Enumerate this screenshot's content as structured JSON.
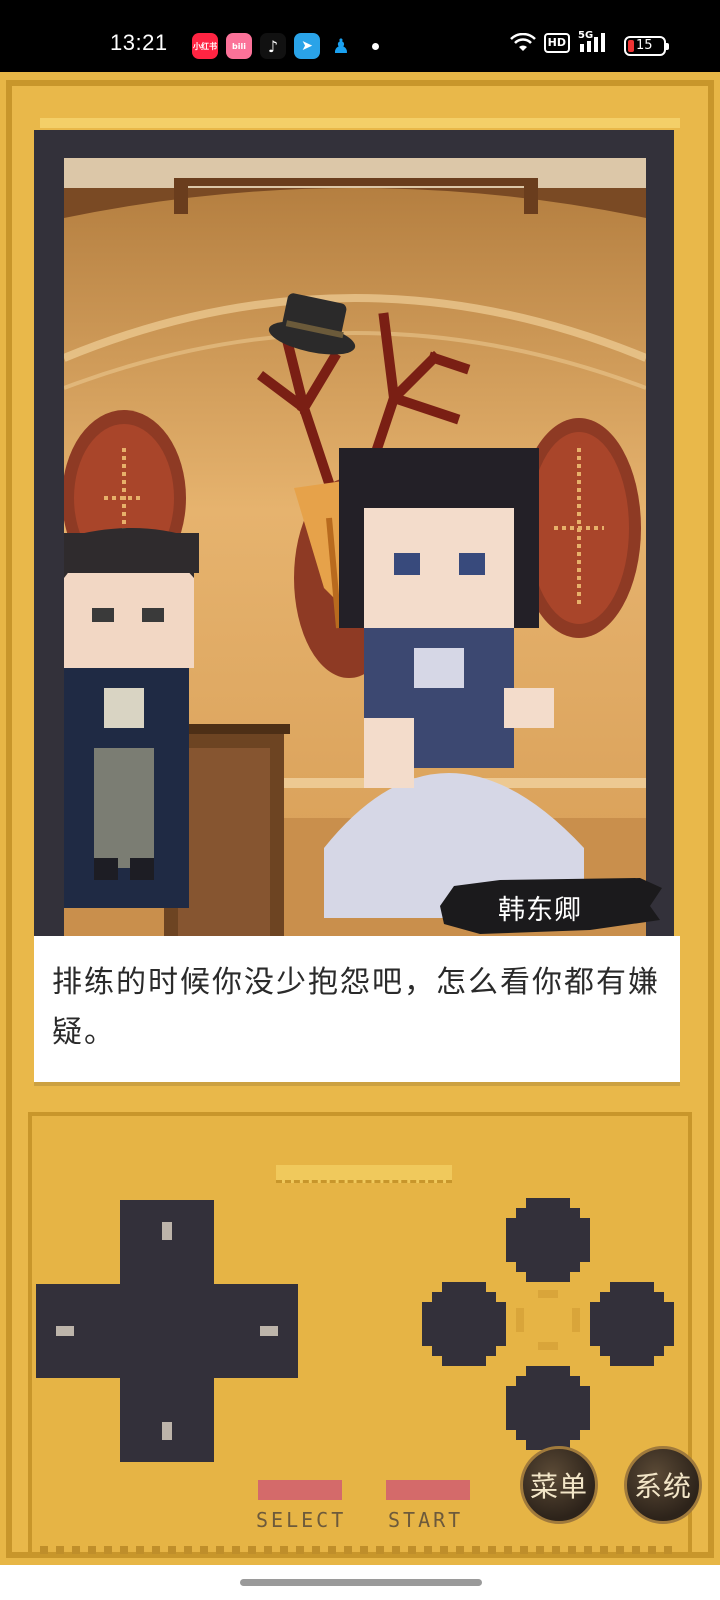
{
  "status_bar": {
    "time": "13:21",
    "apps": [
      {
        "icon": "xiaohongshu-icon",
        "label": "小红书",
        "color": "#ff2442"
      },
      {
        "icon": "bilibili-icon",
        "label": "bili",
        "color": "#fb7299"
      },
      {
        "icon": "tiktok-icon",
        "label": "♪",
        "color": "#111111"
      },
      {
        "icon": "telegram-icon",
        "label": "➤",
        "color": "#2aa3e8"
      },
      {
        "icon": "qq-icon",
        "label": "♟",
        "color": "#1aa1f0"
      }
    ],
    "network_label": "5G",
    "hd_label": "HD",
    "battery": "15"
  },
  "scene": {
    "speaker_name": "韩东卿",
    "dialog_text": "排练的时候你没少抱怨吧，怎么看你都有嫌疑。"
  },
  "controls": {
    "select_label": "SELECT",
    "start_label": "START",
    "menu_label": "菜单",
    "system_label": "系统"
  },
  "colors": {
    "console": "#e7b646",
    "bezel": "#33313a",
    "select_start": "#d46a6a"
  }
}
